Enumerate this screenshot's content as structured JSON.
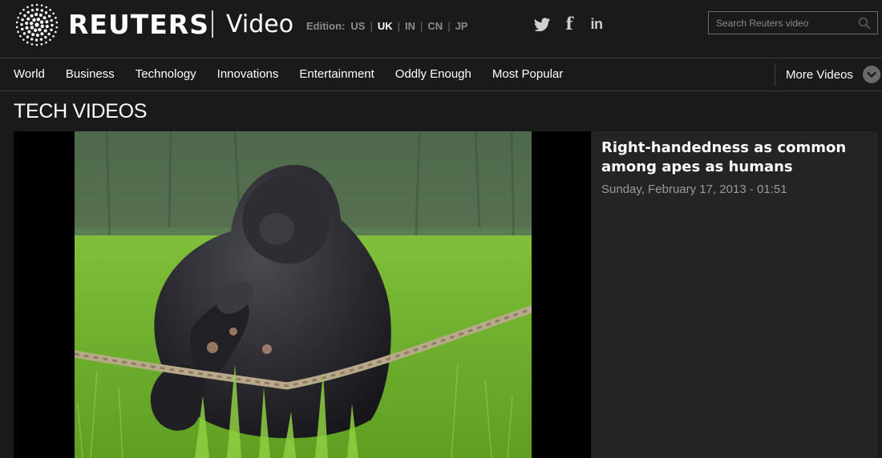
{
  "header": {
    "brand": "REUTERS",
    "section": "Video",
    "edition": {
      "label": "Edition:",
      "options": [
        {
          "code": "US",
          "active": false
        },
        {
          "code": "UK",
          "active": true
        },
        {
          "code": "IN",
          "active": false
        },
        {
          "code": "CN",
          "active": false
        },
        {
          "code": "JP",
          "active": false
        }
      ]
    },
    "social": [
      "twitter-icon",
      "facebook-icon",
      "linkedin-icon"
    ],
    "social_glyphs": {
      "facebook": "f",
      "linkedin": "in"
    },
    "search": {
      "placeholder": "Search Reuters video",
      "value": ""
    }
  },
  "nav": {
    "items": [
      "World",
      "Business",
      "Technology",
      "Innovations",
      "Entertainment",
      "Oddly Enough",
      "Most Popular"
    ],
    "more_label": "More Videos"
  },
  "page": {
    "title": "TECH VIDEOS"
  },
  "featured": {
    "title": "Right-handedness as common among apes as humans",
    "date": "Sunday, February 17, 2013 - 01:51"
  },
  "colors": {
    "background": "#1a1a1a",
    "panel": "#242424",
    "text": "#ffffff",
    "muted": "#9a9a9a"
  }
}
